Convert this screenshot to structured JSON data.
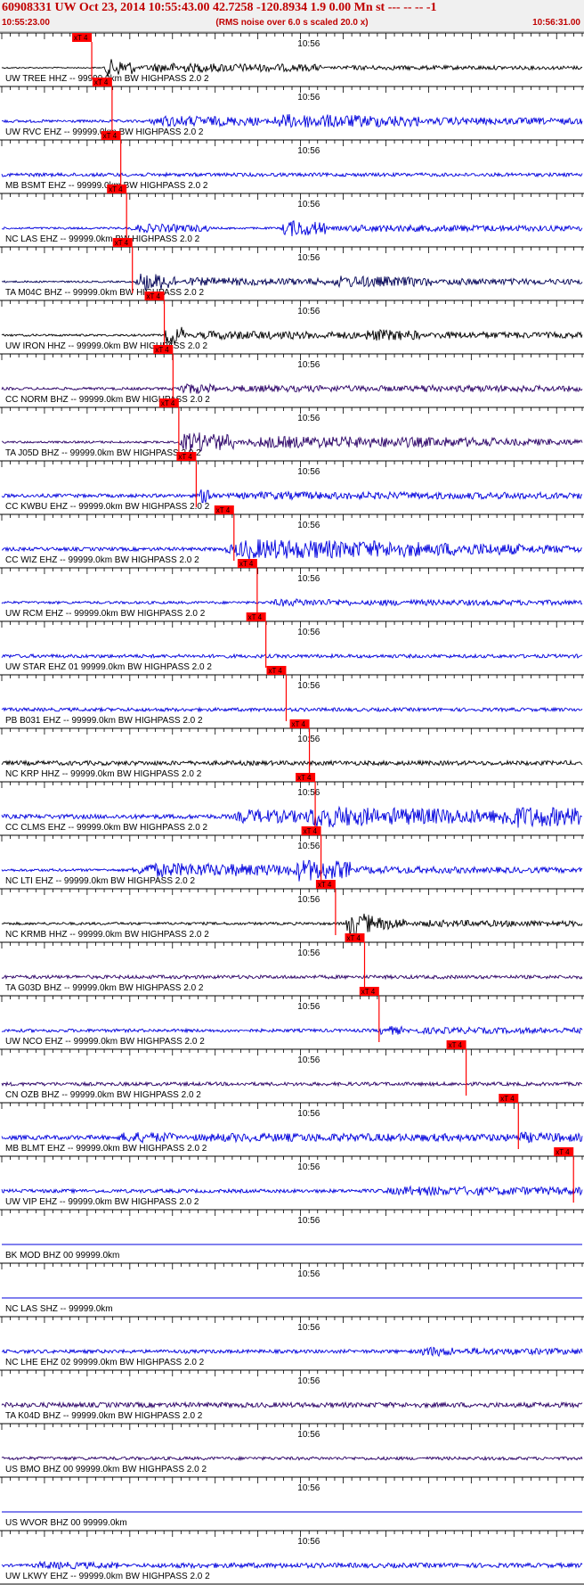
{
  "header": {
    "title": "60908331 UW Oct 23, 2014 10:55:43.00   42.7258 -120.8934  1.9 0.00 Mn st --- -- --  -1",
    "start_time": "10:55:23.00",
    "noise_note": "(RMS noise over 6.0 s scaled 20.0 x)",
    "end_time": "10:56:31.00"
  },
  "colors": {
    "header_text": "#c00000",
    "header_bg": "#f0f0f0",
    "pick": "#ff0000",
    "pick_text": "#000000",
    "blue_trace": "#0000dd",
    "black_trace": "#000000",
    "purple_trace": "#2a0066",
    "navy_trace": "#000055"
  },
  "chart_data": {
    "type": "seismogram",
    "time_range": [
      "10:55:23.00",
      "10:56:31.00"
    ],
    "minute_label": "10:56",
    "pick_label": "xT 4",
    "traces": [
      {
        "label": "UW TREE HHZ -- 99999.0km BW  HIGHPASS  2.0  2",
        "color": "black",
        "pick": 0.155,
        "onset": 0.175,
        "env": [
          [
            0.175,
            0.23,
            10
          ],
          [
            0.23,
            0.55,
            5
          ],
          [
            0.55,
            1.0,
            2
          ]
        ],
        "noise": 0.7
      },
      {
        "label": "UW RVC EHZ -- 99999.0km BW  HIGHPASS  2.0  2",
        "color": "blue",
        "pick": 0.19,
        "onset": 0.25,
        "env": [
          [
            0.25,
            0.45,
            5
          ],
          [
            0.45,
            0.72,
            7
          ],
          [
            0.72,
            1.0,
            3
          ]
        ],
        "noise": 1.5
      },
      {
        "label": "MB BSMT EHZ -- 99999.0km BW  HIGHPASS  2.0  2",
        "color": "blue",
        "pick": 0.205,
        "onset": 1.0,
        "env": [],
        "noise": 2.0
      },
      {
        "label": "NC LAS EHZ -- 99999.0km BW  HIGHPASS  2.0  2",
        "color": "blue",
        "pick": 0.215,
        "onset": 0.22,
        "env": [
          [
            0.22,
            0.36,
            4
          ],
          [
            0.48,
            0.56,
            9
          ],
          [
            0.56,
            1.0,
            3
          ]
        ],
        "noise": 1.2
      },
      {
        "label": "TA M04C BHZ -- 99999.0km BW  HIGHPASS  2.0  2",
        "color": "navy",
        "pick": 0.225,
        "onset": 0.23,
        "env": [
          [
            0.23,
            0.3,
            10
          ],
          [
            0.3,
            0.56,
            4
          ],
          [
            0.56,
            0.74,
            6
          ],
          [
            0.74,
            1.0,
            3
          ]
        ],
        "noise": 1.0
      },
      {
        "label": "UW IRON HHZ -- 99999.0km BW  HIGHPASS  2.0  2",
        "color": "black",
        "pick": 0.28,
        "onset": 0.28,
        "env": [
          [
            0.28,
            0.32,
            11
          ],
          [
            0.32,
            0.62,
            4
          ],
          [
            0.62,
            0.72,
            6
          ],
          [
            0.72,
            1.0,
            3
          ]
        ],
        "noise": 1.2
      },
      {
        "label": "CC NORM BHZ -- 99999.0km BW  HIGHPASS  2.0  2",
        "color": "purple",
        "pick": 0.295,
        "onset": 0.3,
        "env": [
          [
            0.3,
            0.37,
            5
          ],
          [
            0.37,
            0.72,
            2.5
          ],
          [
            0.72,
            0.76,
            4
          ],
          [
            0.76,
            1.0,
            2.5
          ]
        ],
        "noise": 1.5
      },
      {
        "label": "TA J05D BHZ -- 99999.0km BW  HIGHPASS  2.0  2",
        "color": "purple",
        "pick": 0.305,
        "onset": 0.305,
        "env": [
          [
            0.305,
            0.4,
            11
          ],
          [
            0.4,
            0.85,
            6
          ],
          [
            0.85,
            1.0,
            3
          ]
        ],
        "noise": 1.2
      },
      {
        "label": "CC KWBU EHZ -- 99999.0km BW  HIGHPASS  2.0  2",
        "color": "blue",
        "pick": 0.335,
        "onset": 0.34,
        "env": [
          [
            0.34,
            0.37,
            7
          ],
          [
            0.37,
            1.0,
            2.5
          ]
        ],
        "noise": 2.0
      },
      {
        "label": "CC WIZ EHZ -- 99999.0km BW  HIGHPASS  2.0  2",
        "color": "blue",
        "pick": 0.4,
        "onset": 0.38,
        "env": [
          [
            0.38,
            0.72,
            10
          ],
          [
            0.72,
            0.9,
            6
          ],
          [
            0.9,
            1.0,
            3
          ]
        ],
        "noise": 2.0
      },
      {
        "label": "UW RCM EHZ -- 99999.0km BW  HIGHPASS  2.0  2",
        "color": "blue",
        "pick": 0.44,
        "onset": 0.46,
        "env": [
          [
            0.46,
            0.6,
            3
          ],
          [
            0.6,
            1.0,
            2
          ]
        ],
        "noise": 1.5
      },
      {
        "label": "UW STAR EHZ 01 99999.0km BW  HIGHPASS  2.0  2",
        "color": "blue",
        "pick": 0.455,
        "onset": 1.0,
        "env": [],
        "noise": 2.0
      },
      {
        "label": "PB B031 EHZ -- 99999.0km BW  HIGHPASS  2.0  2",
        "color": "blue",
        "pick": 0.49,
        "onset": 1.0,
        "env": [],
        "noise": 2.0
      },
      {
        "label": "NC KRP HHZ -- 99999.0km BW  HIGHPASS  2.0  2",
        "color": "black",
        "pick": 0.53,
        "onset": 1.0,
        "env": [],
        "noise": 2.5
      },
      {
        "label": "CC CLMS EHZ -- 99999.0km BW  HIGHPASS  2.0  2",
        "color": "blue",
        "pick": 0.54,
        "onset": 0.4,
        "env": [
          [
            0.4,
            0.52,
            6
          ],
          [
            0.52,
            0.65,
            11
          ],
          [
            0.65,
            0.85,
            8
          ],
          [
            0.85,
            1.0,
            11
          ]
        ],
        "noise": 2.5
      },
      {
        "label": "NC LTI EHZ -- 99999.0km BW  HIGHPASS  2.0  2",
        "color": "blue",
        "pick": 0.55,
        "onset": 0.22,
        "env": [
          [
            0.22,
            0.5,
            7
          ],
          [
            0.5,
            0.6,
            12
          ],
          [
            0.6,
            0.82,
            3
          ],
          [
            0.82,
            1.0,
            2
          ]
        ],
        "noise": 1.5
      },
      {
        "label": "NC KRMB HHZ -- 99999.0km BW  HIGHPASS  2.0  2",
        "color": "black",
        "pick": 0.575,
        "onset": 0.59,
        "env": [
          [
            0.59,
            0.64,
            13
          ],
          [
            0.64,
            0.7,
            6
          ],
          [
            0.7,
            1.0,
            2.5
          ]
        ],
        "noise": 1.5
      },
      {
        "label": "TA G03D BHZ -- 99999.0km BW  HIGHPASS  2.0  2",
        "color": "purple",
        "pick": 0.625,
        "onset": 1.0,
        "env": [],
        "noise": 2.0
      },
      {
        "label": "UW NCO EHZ -- 99999.0km BW  HIGHPASS  2.0  2",
        "color": "blue",
        "pick": 0.65,
        "onset": 0.65,
        "env": [
          [
            0.65,
            0.69,
            4
          ],
          [
            0.69,
            1.0,
            2
          ]
        ],
        "noise": 1.8
      },
      {
        "label": "CN OZB BHZ -- 99999.0km BW  HIGHPASS  2.0  2",
        "color": "purple",
        "pick": 0.8,
        "onset": 1.0,
        "env": [],
        "noise": 2.0
      },
      {
        "label": "MB BLMT EHZ -- 99999.0km BW  HIGHPASS  2.0  2",
        "color": "blue",
        "pick": 0.89,
        "onset": 0.2,
        "env": [
          [
            0.2,
            0.3,
            4
          ],
          [
            0.3,
            0.89,
            2.5
          ],
          [
            0.89,
            0.93,
            4
          ],
          [
            0.93,
            1.0,
            3
          ]
        ],
        "noise": 2.5
      },
      {
        "label": "UW VIP EHZ -- 99999.0km BW  HIGHPASS  2.0  2",
        "color": "blue",
        "pick": 0.985,
        "onset": 0.65,
        "env": [
          [
            0.65,
            1.0,
            3.5
          ]
        ],
        "noise": 2.0
      },
      {
        "label": "BK MOD BHZ 00 99999.0km",
        "color": "blue",
        "pick": null,
        "onset": 1.0,
        "env": [],
        "noise": 0
      },
      {
        "label": "NC LAS SHZ -- 99999.0km",
        "color": "blue",
        "pick": null,
        "onset": 1.0,
        "env": [],
        "noise": 0
      },
      {
        "label": "NC LHE EHZ 02 99999.0km BW  HIGHPASS  2.0  2",
        "color": "blue",
        "pick": null,
        "onset": 0.72,
        "env": [
          [
            0.72,
            0.78,
            4
          ],
          [
            0.78,
            1.0,
            2
          ]
        ],
        "noise": 2.0
      },
      {
        "label": "TA K04D BHZ -- 99999.0km BW  HIGHPASS  2.0  2",
        "color": "purple",
        "pick": null,
        "onset": 1.0,
        "env": [],
        "noise": 2.8
      },
      {
        "label": "US BMO BHZ 00 99999.0km BW  HIGHPASS  2.0  2",
        "color": "purple",
        "pick": null,
        "onset": 1.0,
        "env": [],
        "noise": 1.8
      },
      {
        "label": "US WVOR BHZ 00 99999.0km",
        "color": "blue",
        "pick": null,
        "onset": 1.0,
        "env": [],
        "noise": 0
      },
      {
        "label": "UW LKWY EHZ -- 99999.0km BW  HIGHPASS  2.0  2",
        "color": "blue",
        "pick": null,
        "onset": 0.05,
        "env": [
          [
            0.05,
            0.2,
            3
          ],
          [
            0.2,
            1.0,
            1.5
          ]
        ],
        "noise": 1.5
      }
    ]
  }
}
